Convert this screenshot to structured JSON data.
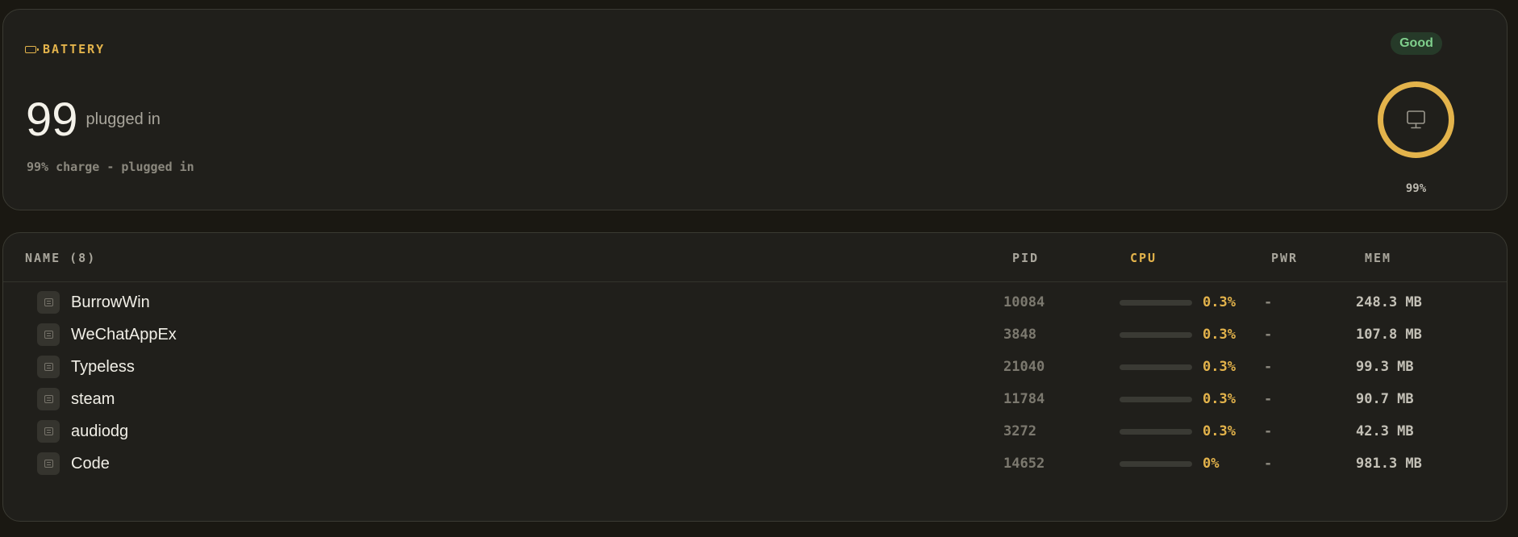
{
  "battery": {
    "header": "BATTERY",
    "value": "99",
    "status": "plugged in",
    "detail": "99% charge - plugged in",
    "health_badge": "Good",
    "percent_label": "99%",
    "charge_fraction": 0.99,
    "ring_color": "#e3b34b",
    "ring_icon": "monitor-icon"
  },
  "table": {
    "columns": {
      "name": "NAME (8)",
      "pid": "PID",
      "cpu": "CPU",
      "pwr": "PWR",
      "mem": "MEM"
    },
    "sorted_by": "cpu",
    "rows": [
      {
        "name": "BurrowWin",
        "pid": "10084",
        "cpu": "0.3%",
        "cpu_fraction": 0.003,
        "pwr": "-",
        "mem": "248.3 MB"
      },
      {
        "name": "WeChatAppEx",
        "pid": "3848",
        "cpu": "0.3%",
        "cpu_fraction": 0.003,
        "pwr": "-",
        "mem": "107.8 MB"
      },
      {
        "name": "Typeless",
        "pid": "21040",
        "cpu": "0.3%",
        "cpu_fraction": 0.003,
        "pwr": "-",
        "mem": "99.3 MB"
      },
      {
        "name": "steam",
        "pid": "11784",
        "cpu": "0.3%",
        "cpu_fraction": 0.003,
        "pwr": "-",
        "mem": "90.7 MB"
      },
      {
        "name": "audiodg",
        "pid": "3272",
        "cpu": "0.3%",
        "cpu_fraction": 0.003,
        "pwr": "-",
        "mem": "42.3 MB"
      },
      {
        "name": "Code",
        "pid": "14652",
        "cpu": "0%",
        "cpu_fraction": 0,
        "pwr": "-",
        "mem": "981.3 MB"
      }
    ]
  },
  "colors": {
    "accent": "#e3b34b",
    "good": "#7fcf8c",
    "background": "#1a1812",
    "panel": "#201f1b"
  }
}
